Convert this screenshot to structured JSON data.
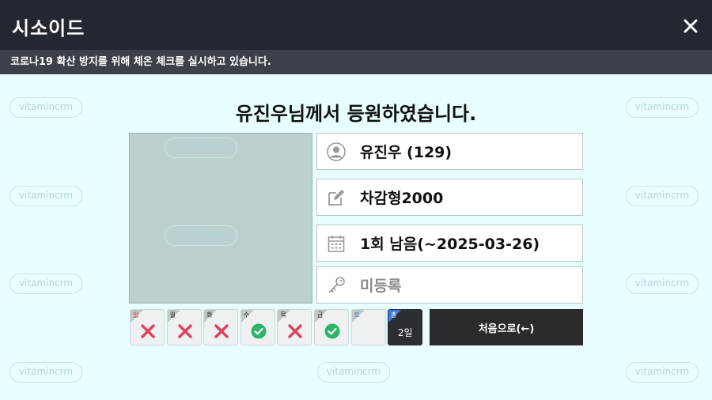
{
  "window": {
    "title": "시소이드"
  },
  "notice": "코로나19 확산 방지를 위해 체온 체크를 실시하고 있습니다.",
  "watermark": "vitamincrm",
  "headline": "유진우님께서 등원하였습니다.",
  "member": {
    "name": "유진우 (129)",
    "vehicle": "차감형2000",
    "remaining": "1회 남음(~2025-03-26)",
    "key_status": "미등록"
  },
  "attendance": {
    "days": [
      {
        "label": "일",
        "status": "absent",
        "label_color": "red"
      },
      {
        "label": "월",
        "status": "absent",
        "label_color": "default"
      },
      {
        "label": "화",
        "status": "absent",
        "label_color": "default"
      },
      {
        "label": "수",
        "status": "present",
        "label_color": "default"
      },
      {
        "label": "목",
        "status": "absent",
        "label_color": "default"
      },
      {
        "label": "금",
        "status": "present",
        "label_color": "default"
      },
      {
        "label": "토",
        "status": "none",
        "label_color": "blue"
      }
    ],
    "total": {
      "label": "총",
      "count": "2일"
    }
  },
  "back_button": "처음으로(←)",
  "colors": {
    "absent": "#e0405e",
    "present": "#2fb36b",
    "titlebar": "#23272f",
    "background": "#e8fdfd"
  }
}
